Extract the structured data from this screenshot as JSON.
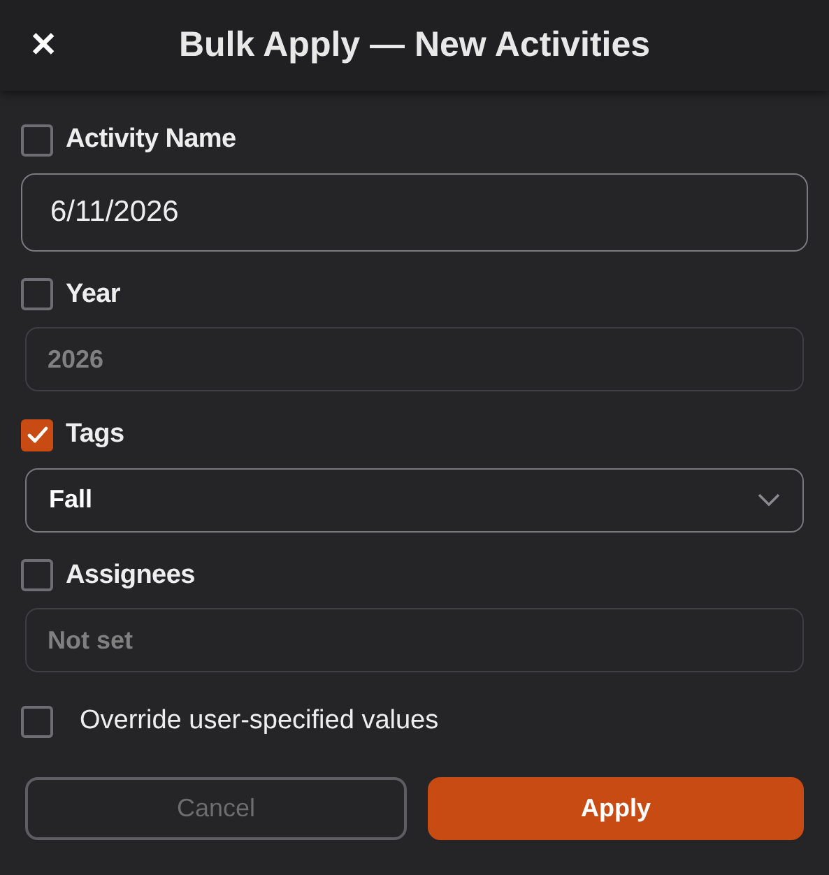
{
  "header": {
    "close": "✕",
    "title": "Bulk Apply — New Activities"
  },
  "fields": [
    {
      "label": "Activity Name",
      "checked": false,
      "kind": "text",
      "value": "6/11/2026",
      "disabled": false
    },
    {
      "label": "Year",
      "checked": false,
      "kind": "text",
      "value": "2026",
      "disabled": true
    },
    {
      "label": "Tags",
      "checked": true,
      "kind": "select",
      "value": "Fall",
      "disabled": false
    },
    {
      "label": "Assignees",
      "checked": false,
      "kind": "text",
      "value": "Not set",
      "disabled": true
    }
  ],
  "override": {
    "label": "Override user-specified values",
    "checked": false
  },
  "buttons": [
    {
      "label": "Cancel",
      "kind": "secondary",
      "disabled": true
    },
    {
      "label": "Apply",
      "kind": "primary",
      "disabled": false
    }
  ]
}
